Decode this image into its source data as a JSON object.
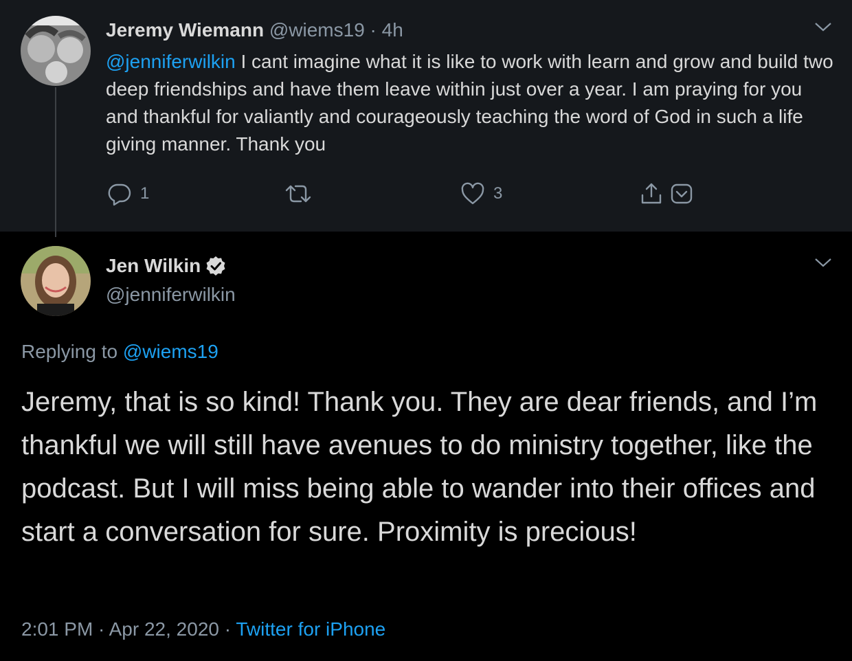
{
  "parent_tweet": {
    "author_name": "Jeremy Wiemann",
    "handle": "@wiems19",
    "separator": "·",
    "time": "4h",
    "mention": "@jenniferwilkin",
    "text": " I cant imagine what it is like to work with learn and grow and build two deep friendships and have them leave within just over a year. I am praying for you and thankful for valiantly and courageously teaching the word of God in such a life giving manner. Thank you",
    "reply_count": "1",
    "retweet_count": "",
    "like_count": "3",
    "icons": [
      "reply-icon",
      "retweet-icon",
      "like-icon",
      "share-icon",
      "bookmark-icon",
      "chevron-down-icon"
    ]
  },
  "main_tweet": {
    "author_name": "Jen Wilkin",
    "verified": true,
    "handle": "@jenniferwilkin",
    "replying_prefix": "Replying to ",
    "replying_handle": "@wiems19",
    "text": "Jeremy, that is so kind! Thank you. They are dear friends, and I’m thankful we will still have avenues to do ministry together, like the podcast. But I will miss being able to wander into their offices and start a conversation for sure. Proximity is precious!",
    "time": "2:01 PM",
    "separator": " · ",
    "date": "Apr 22, 2020",
    "source": "Twitter for iPhone"
  },
  "colors": {
    "accent": "#1da1f2",
    "muted": "#8b98a5",
    "text": "#d9d9d9",
    "parent_bg": "#15181c",
    "main_bg": "#000000"
  }
}
